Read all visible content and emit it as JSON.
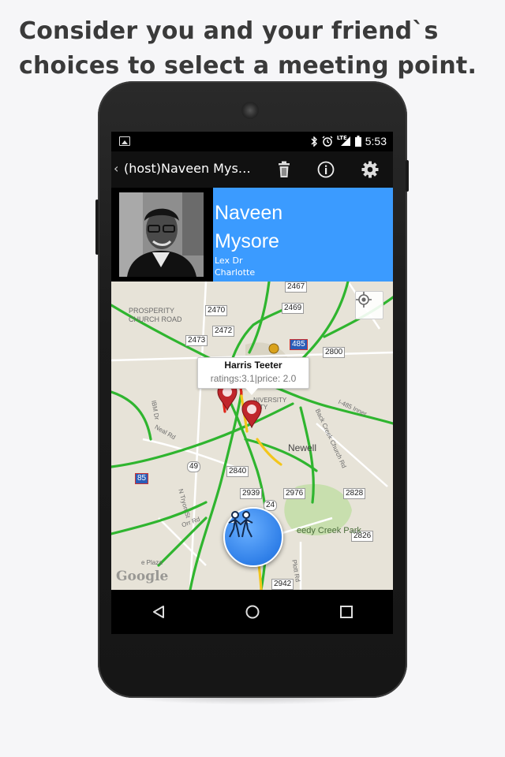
{
  "headline": {
    "line1": "Consider you and your friend`s",
    "line2": "choices to select a meeting point."
  },
  "status_bar": {
    "time": "5:53",
    "lte": "LTE",
    "icons": [
      "image-icon",
      "bluetooth-icon",
      "alarm-icon",
      "signal-icon",
      "battery-icon"
    ]
  },
  "action_bar": {
    "back_glyph": "‹",
    "title": "(host)Naveen Mys…",
    "actions": [
      "delete-icon",
      "info-icon",
      "settings-icon"
    ]
  },
  "profile": {
    "first_name": "Naveen",
    "last_name": "Mysore",
    "street": "Lex Dr",
    "city": "Charlotte",
    "card_color": "#3b9bff"
  },
  "map": {
    "info_window": {
      "name": "Harris Teeter",
      "details": "ratings:3.1|price: 2.0"
    },
    "road_labels": [
      "2467",
      "2470",
      "2469",
      "2472",
      "485",
      "2473",
      "2800",
      "85",
      "49",
      "2840",
      "2939",
      "2976",
      "2828",
      "24",
      "2826",
      "2942"
    ],
    "place_labels": {
      "prosperity_1": "PROSPERITY",
      "prosperity_2": "CHURCH ROAD",
      "newell": "Newell",
      "reedy_creek": "eedy Creek Park",
      "university_1": "NIVERSITY",
      "university_2": "CITY",
      "back_creek": "Back Creek Church Rd",
      "i485": "I-485 Inner",
      "ibm": "IBM Dr",
      "neal": "Neal Rd",
      "tryon": "N Tryon St",
      "orr": "Orr Rd",
      "plaza": "e Plaza",
      "plott": "Plott Rd"
    },
    "watermark": "Google",
    "colors": {
      "traffic_green": "#2fb52f",
      "traffic_red": "#e0261b",
      "traffic_yellow": "#f3c61b",
      "pin": "#c0262c"
    }
  },
  "nav_bar": {
    "buttons": [
      "back-nav-icon",
      "home-nav-icon",
      "recents-nav-icon"
    ]
  }
}
